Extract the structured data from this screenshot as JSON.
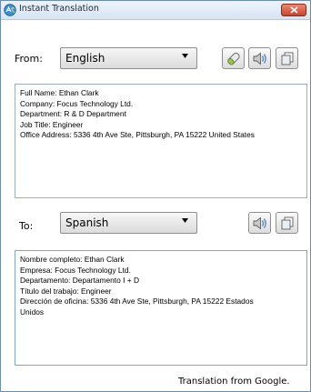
{
  "window": {
    "title": "Instant Translation",
    "icon": "app-translate-icon"
  },
  "from": {
    "label": "From:",
    "selected": "English",
    "buttons": [
      "eraser-icon",
      "speaker-icon",
      "copy-icon"
    ],
    "lines": [
      "Full Name: Ethan Clark",
      "Company: Focus Technology Ltd.",
      "Department: R & D Department",
      "Job Title: Engineer",
      "Office Address: 5336 4th Ave Ste, Pittsburgh, PA 15222 United States"
    ]
  },
  "to": {
    "label": "To:",
    "selected": "Spanish",
    "buttons": [
      "speaker-icon",
      "copy-icon"
    ],
    "lines": [
      "Nombre completo: Ethan Clark",
      "Empresa: Focus Technology Ltd.",
      "Departamento: Departamento I + D",
      "Título del trabajo: Engineer",
      "Dirección de oficina: 5336 4th Ave Ste, Pittsburgh, PA 15222 Estados",
      "Unidos"
    ]
  },
  "footer": "Translation from Google.",
  "colors": {
    "titlebar": "#dbe7f5",
    "close": "#c7442a",
    "focus_border": "#7aa7d6"
  }
}
